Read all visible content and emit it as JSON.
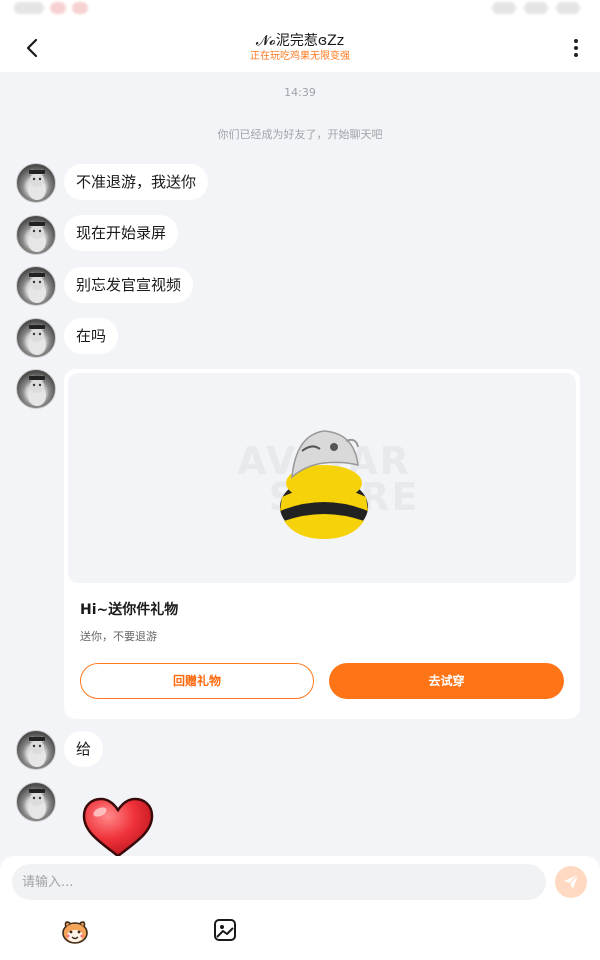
{
  "header": {
    "title": "𝓝𝓸泥完惹ɞZz",
    "subtitle": "正在玩吃鸡果无限变强"
  },
  "chat": {
    "timestamp": "14:39",
    "system_message": "你们已经成为好友了，开始聊天吧",
    "messages": [
      {
        "type": "text",
        "text": "不准退游，我送你"
      },
      {
        "type": "text",
        "text": "现在开始录屏"
      },
      {
        "type": "text",
        "text": "别忘发官宣视频"
      },
      {
        "type": "text",
        "text": "在吗"
      },
      {
        "type": "text",
        "text": "给"
      }
    ],
    "gift_card": {
      "watermark_line1": "AVATAR",
      "watermark_line2": "STORE",
      "title": "Hi~送你件礼物",
      "description": "送你，不要退游",
      "return_gift_label": "回赠礼物",
      "try_on_label": "去试穿"
    },
    "sticker": "heart"
  },
  "input": {
    "placeholder": "请输入..."
  },
  "icons": {
    "back": "back-arrow-icon",
    "more": "more-vertical-icon",
    "send": "send-icon",
    "emoji": "emoji-face-icon",
    "image": "image-icon"
  },
  "colors": {
    "accent": "#ff7416",
    "background": "#f3f4f7",
    "send_disabled": "#ffd9c2"
  }
}
